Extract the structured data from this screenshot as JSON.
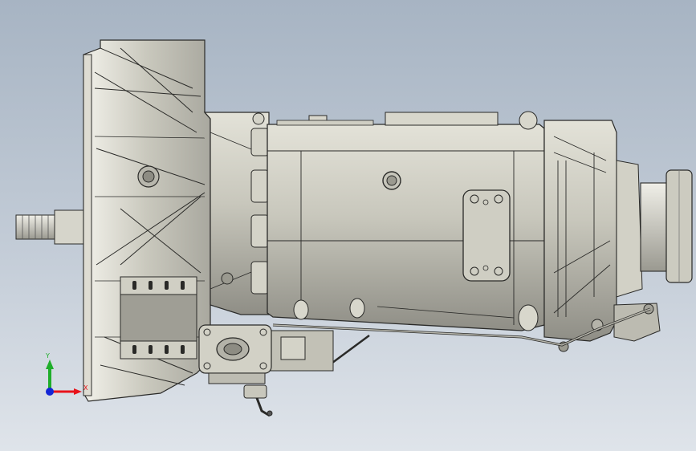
{
  "triad": {
    "x_label": "X",
    "y_label": "Y",
    "x_color": "#e8121a",
    "y_color": "#1fae2a",
    "z_color": "#1426d6"
  },
  "model": {
    "body_color": "#c5c4b9",
    "shadow_color": "#8d8c83",
    "line_color": "#2a2a28"
  }
}
